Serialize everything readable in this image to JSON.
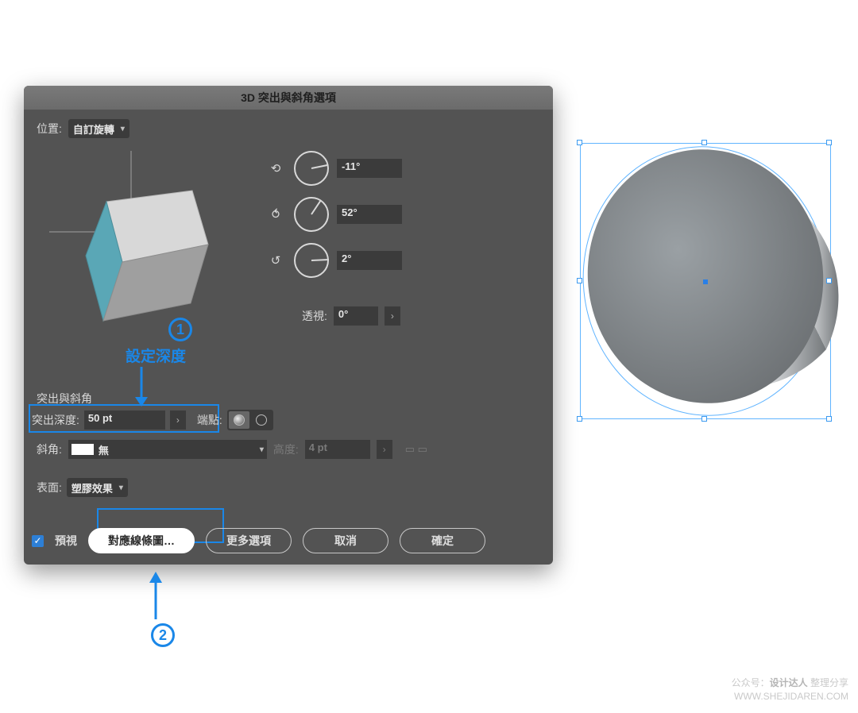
{
  "dialog": {
    "title": "3D 突出與斜角選項",
    "position_label": "位置:",
    "position_value": "自訂旋轉",
    "rotation": {
      "x": "-11°",
      "y": "52°",
      "z": "2°"
    },
    "perspective_label": "透視:",
    "perspective_value": "0°",
    "section_title": "突出與斜角",
    "extrude_depth_label": "突出深度:",
    "extrude_depth_value": "50 pt",
    "cap_label": "端點:",
    "bevel_label": "斜角:",
    "bevel_value": "無",
    "height_label": "高度:",
    "height_value": "4 pt",
    "surface_label": "表面:",
    "surface_value": "塑膠效果",
    "preview_label": "預視",
    "buttons": {
      "map_art": "對應線條圖…",
      "more": "更多選項",
      "cancel": "取消",
      "ok": "確定"
    }
  },
  "annotations": {
    "step1_num": "1",
    "step1_text": "設定深度",
    "step2_num": "2"
  },
  "watermark": {
    "line1_prefix": "公众号：",
    "line1_name": "设计达人",
    "line1_suffix": " 整理分享",
    "line2": "WWW.SHEJIDAREN.COM"
  }
}
